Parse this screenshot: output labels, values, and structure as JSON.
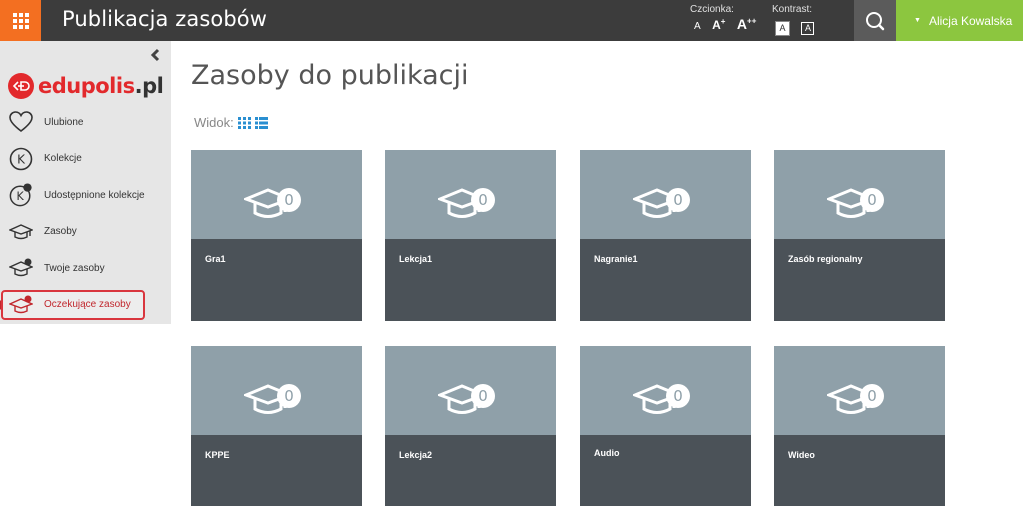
{
  "app": {
    "title": "Publikacja zasobów"
  },
  "header": {
    "font_label": "Czcionka:",
    "font_sizes": [
      "A",
      "A",
      "+",
      "A",
      "++"
    ],
    "contrast_label": "Kontrast:",
    "contrast_options": [
      "A",
      "A"
    ],
    "user_name": "Alicja Kowalska",
    "colors": {
      "bar": "#3c3c3c",
      "apps": "#f36f21",
      "search": "#5b5b5b",
      "user": "#8cc63f"
    }
  },
  "sidebar": {
    "logo": {
      "brand": "edupolis",
      "tld": ".pl"
    },
    "items": [
      {
        "label": "Ulubione",
        "icon": "heart-icon"
      },
      {
        "label": "Kolekcje",
        "icon": "collection-icon"
      },
      {
        "label": "Udostępnione kolekcje",
        "icon": "shared-collection-icon"
      },
      {
        "label": "Zasoby",
        "icon": "graduation-cap-icon"
      },
      {
        "label": "Twoje zasoby",
        "icon": "my-resources-icon"
      },
      {
        "label": "Oczekujące zasoby",
        "icon": "pending-resources-icon",
        "active": true
      }
    ]
  },
  "main": {
    "title": "Zasoby do publikacji",
    "view_label": "Widok:",
    "tiles": [
      {
        "label": "Gra1",
        "count": "0"
      },
      {
        "label": "Lekcja1",
        "count": "0"
      },
      {
        "label": "Nagranie1",
        "count": "0"
      },
      {
        "label": "Zasób regionalny",
        "count": "0"
      },
      {
        "label": "KPPE",
        "count": "0"
      },
      {
        "label": "Lekcja2",
        "count": "0"
      },
      {
        "label": "Audio",
        "count": "0"
      },
      {
        "label": "Wideo",
        "count": "0"
      }
    ]
  }
}
